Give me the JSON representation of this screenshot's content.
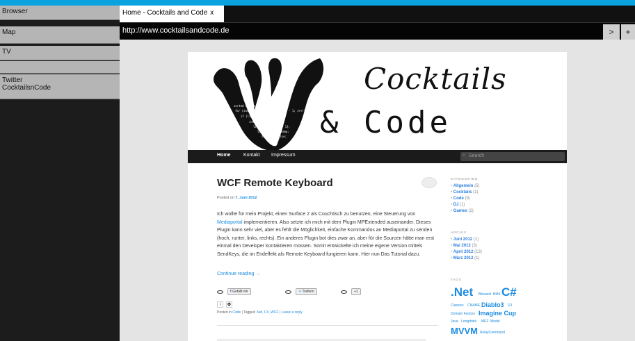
{
  "sidebar": {
    "items": [
      {
        "label": "Browser"
      },
      {
        "label": "Map"
      },
      {
        "label": "TV"
      },
      {
        "label": ""
      },
      {
        "label": "Twitter\nCocktailsnCode"
      }
    ]
  },
  "tab": {
    "title": "Home - Cocktails and Code",
    "close": "x"
  },
  "address": {
    "url": "http://www.cocktailsandcode.de",
    "go": ">",
    "add": "+"
  },
  "site": {
    "name_line1": "Cocktails",
    "name_line2": "& Code",
    "nav": [
      "Home",
      "Kontakt",
      "Impressum"
    ],
    "search_placeholder": "Search"
  },
  "post": {
    "title": "WCF Remote Keyboard",
    "posted_prefix": "Posted on ",
    "posted_date": "7. Juni 2012",
    "body_1a": "Ich wollte für mein Projekt, einen Surface 2 als Couchtisch zu benutzen, eine Steuerung von ",
    "body_1_link": "Mediaportal",
    "body_1b": " implementieren. Also setzte ich mich mit dem Plugin MPExtended auseinander. Dieses Plugin kann sehr viel, aber es fehlt die Möglichkeit, einfache Kommandos an Mediaportal zu senden (hoch, runter, links, rechts). Ein anderes Plugin bot dies zwar an, aber für die Sourcen hätte man erst einmal den Developer kontaktieren müssen. Somit entwickelte ich meine eigene Version mittels SendKeys, die im Endeffekt als Remote Keyboard fungieren kann. Hier nun Das Tutorial dazu.",
    "continue": "Continue reading →",
    "share": [
      "Gefällt mir",
      "Twittern",
      "+1"
    ],
    "meta_prefix": "Posted in ",
    "meta_cat": "Code",
    "meta_mid": " | Tagged ",
    "meta_tags": ".Net, C#, WCF",
    "meta_sep": " | ",
    "meta_reply": "Leave a reply"
  },
  "widgets": {
    "kategorien_title": "KATEGORIEN",
    "kategorien": [
      {
        "name": "Allgemein",
        "count": "(5)"
      },
      {
        "name": "Cocktails",
        "count": "(1)"
      },
      {
        "name": "Code",
        "count": "(9)"
      },
      {
        "name": "DJ",
        "count": "(1)"
      },
      {
        "name": "Games",
        "count": "(2)"
      }
    ],
    "archiv_title": "ARCHIV",
    "archiv": [
      {
        "name": "Juni 2012",
        "count": "(1)"
      },
      {
        "name": "Mai 2012",
        "count": "(3)"
      },
      {
        "name": "April 2012",
        "count": "(13)"
      },
      {
        "name": "März 2012",
        "count": "(1)"
      }
    ],
    "tags_title": "TAGS",
    "tags": [
      ".Net",
      "Blizzard",
      "BMX",
      "C#",
      "Classics",
      "CNAME",
      "Diablo3",
      "DJ",
      "Domain Factory",
      "Imagine Cup",
      "Java",
      "Longdrink",
      "MEF",
      "Model",
      "MVVM",
      "RelayCommand"
    ]
  },
  "colors": {
    "accent": "#0aa3e0",
    "link": "#1b8be0",
    "nav": "#1b1b1b"
  }
}
